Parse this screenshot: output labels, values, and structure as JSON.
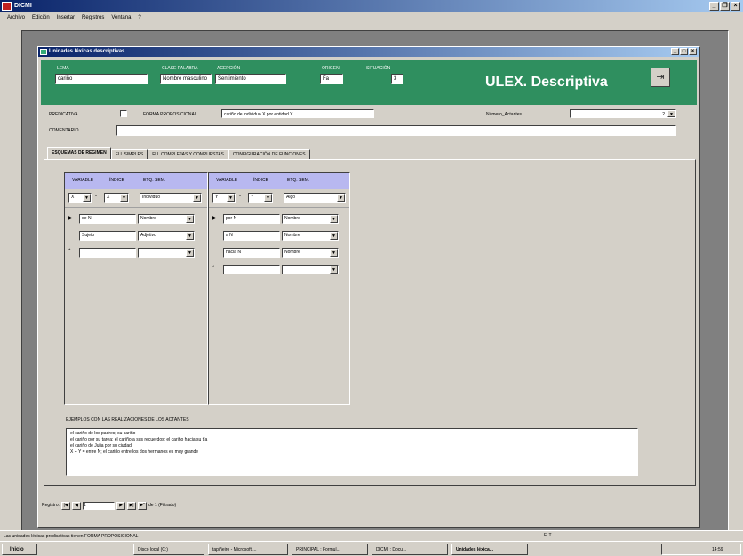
{
  "app": {
    "title": "DICMI"
  },
  "menu": [
    "Archivo",
    "Edición",
    "Insertar",
    "Registros",
    "Ventana",
    "?"
  ],
  "form": {
    "title": "Unidades léxicas descriptivas",
    "brand": "ULEX. Descriptiva",
    "header": {
      "lema_label": "LEMA",
      "lema": "cariño",
      "clase_label": "CLASE PALABRA",
      "clase": "Nombre masculino",
      "acepcion_label": "ACEPCIÓN",
      "acepcion": "Sentimiento",
      "origen_label": "ORIGEN",
      "origen": "Fa",
      "situacion_label": "SITUACIÓN",
      "situacion": "3"
    },
    "predicativa_label": "PREDICATIVA",
    "forma_label": "FORMA PROPOSICIONAL",
    "forma": "cariño de individuo X por entidad Y",
    "numero_label": "Número_Actantes",
    "numero": "2",
    "comentario_label": "COMENTARIO",
    "comentario": ""
  },
  "tabs": [
    "ESQUEMAS DE REGIMEN",
    "FLL SIMPLES",
    "FLL COMPLEJAS Y COMPUESTAS",
    "CONFIGURACIÓN DE FUNCIONES"
  ],
  "left_sub": {
    "headers": [
      "VARIABLE",
      "ÍNDICE",
      "ETQ. SEM."
    ],
    "top": [
      "X",
      "X",
      "Individuo"
    ],
    "rows": [
      {
        "marker": "▶",
        "c1": "de N",
        "c2": "Nombre"
      },
      {
        "marker": "",
        "c1": "Sujeto",
        "c2": "Adjetivo"
      },
      {
        "marker": "*",
        "c1": "",
        "c2": ""
      }
    ]
  },
  "right_sub": {
    "headers": [
      "VARIABLE",
      "ÍNDICE",
      "ETQ. SEM."
    ],
    "top": [
      "Y",
      "Y",
      "Algo"
    ],
    "rows": [
      {
        "marker": "▶",
        "c1": "por N",
        "c2": "Nombre"
      },
      {
        "marker": "",
        "c1": "a N",
        "c2": "Nombre"
      },
      {
        "marker": "",
        "c1": "hacia N",
        "c2": "Nombre"
      },
      {
        "marker": "*",
        "c1": "",
        "c2": ""
      }
    ]
  },
  "examples": {
    "label": "EJEMPLOS CON LAS REALIZACIONES DE LOS ACTANTES",
    "lines": [
      "el cariño de los padres; su cariño",
      "el cariño por su tarea; el cariño a sus recuerdos; el cariño hacia su tía",
      "el cariño de Julia por su ciudad",
      "X + Y = entre N; el cariño entre los dos hermanos es muy grande"
    ]
  },
  "nav": {
    "label": "Registro:",
    "current": "1",
    "total": "de 1 (Filtrado)"
  },
  "status": {
    "text": "Las unidades léxicas predicativas tienen FORMA PROPOSICIONAL",
    "fltr": "FLT"
  },
  "taskbar": {
    "start": "Inicio",
    "items": [
      "Disco local (C:)",
      "tapiñeiro - Microsoft ...",
      "PRINCIPAL : Formul...",
      "DICMI : Docu...",
      "Unidades léxica..."
    ],
    "clock": "14:59"
  }
}
